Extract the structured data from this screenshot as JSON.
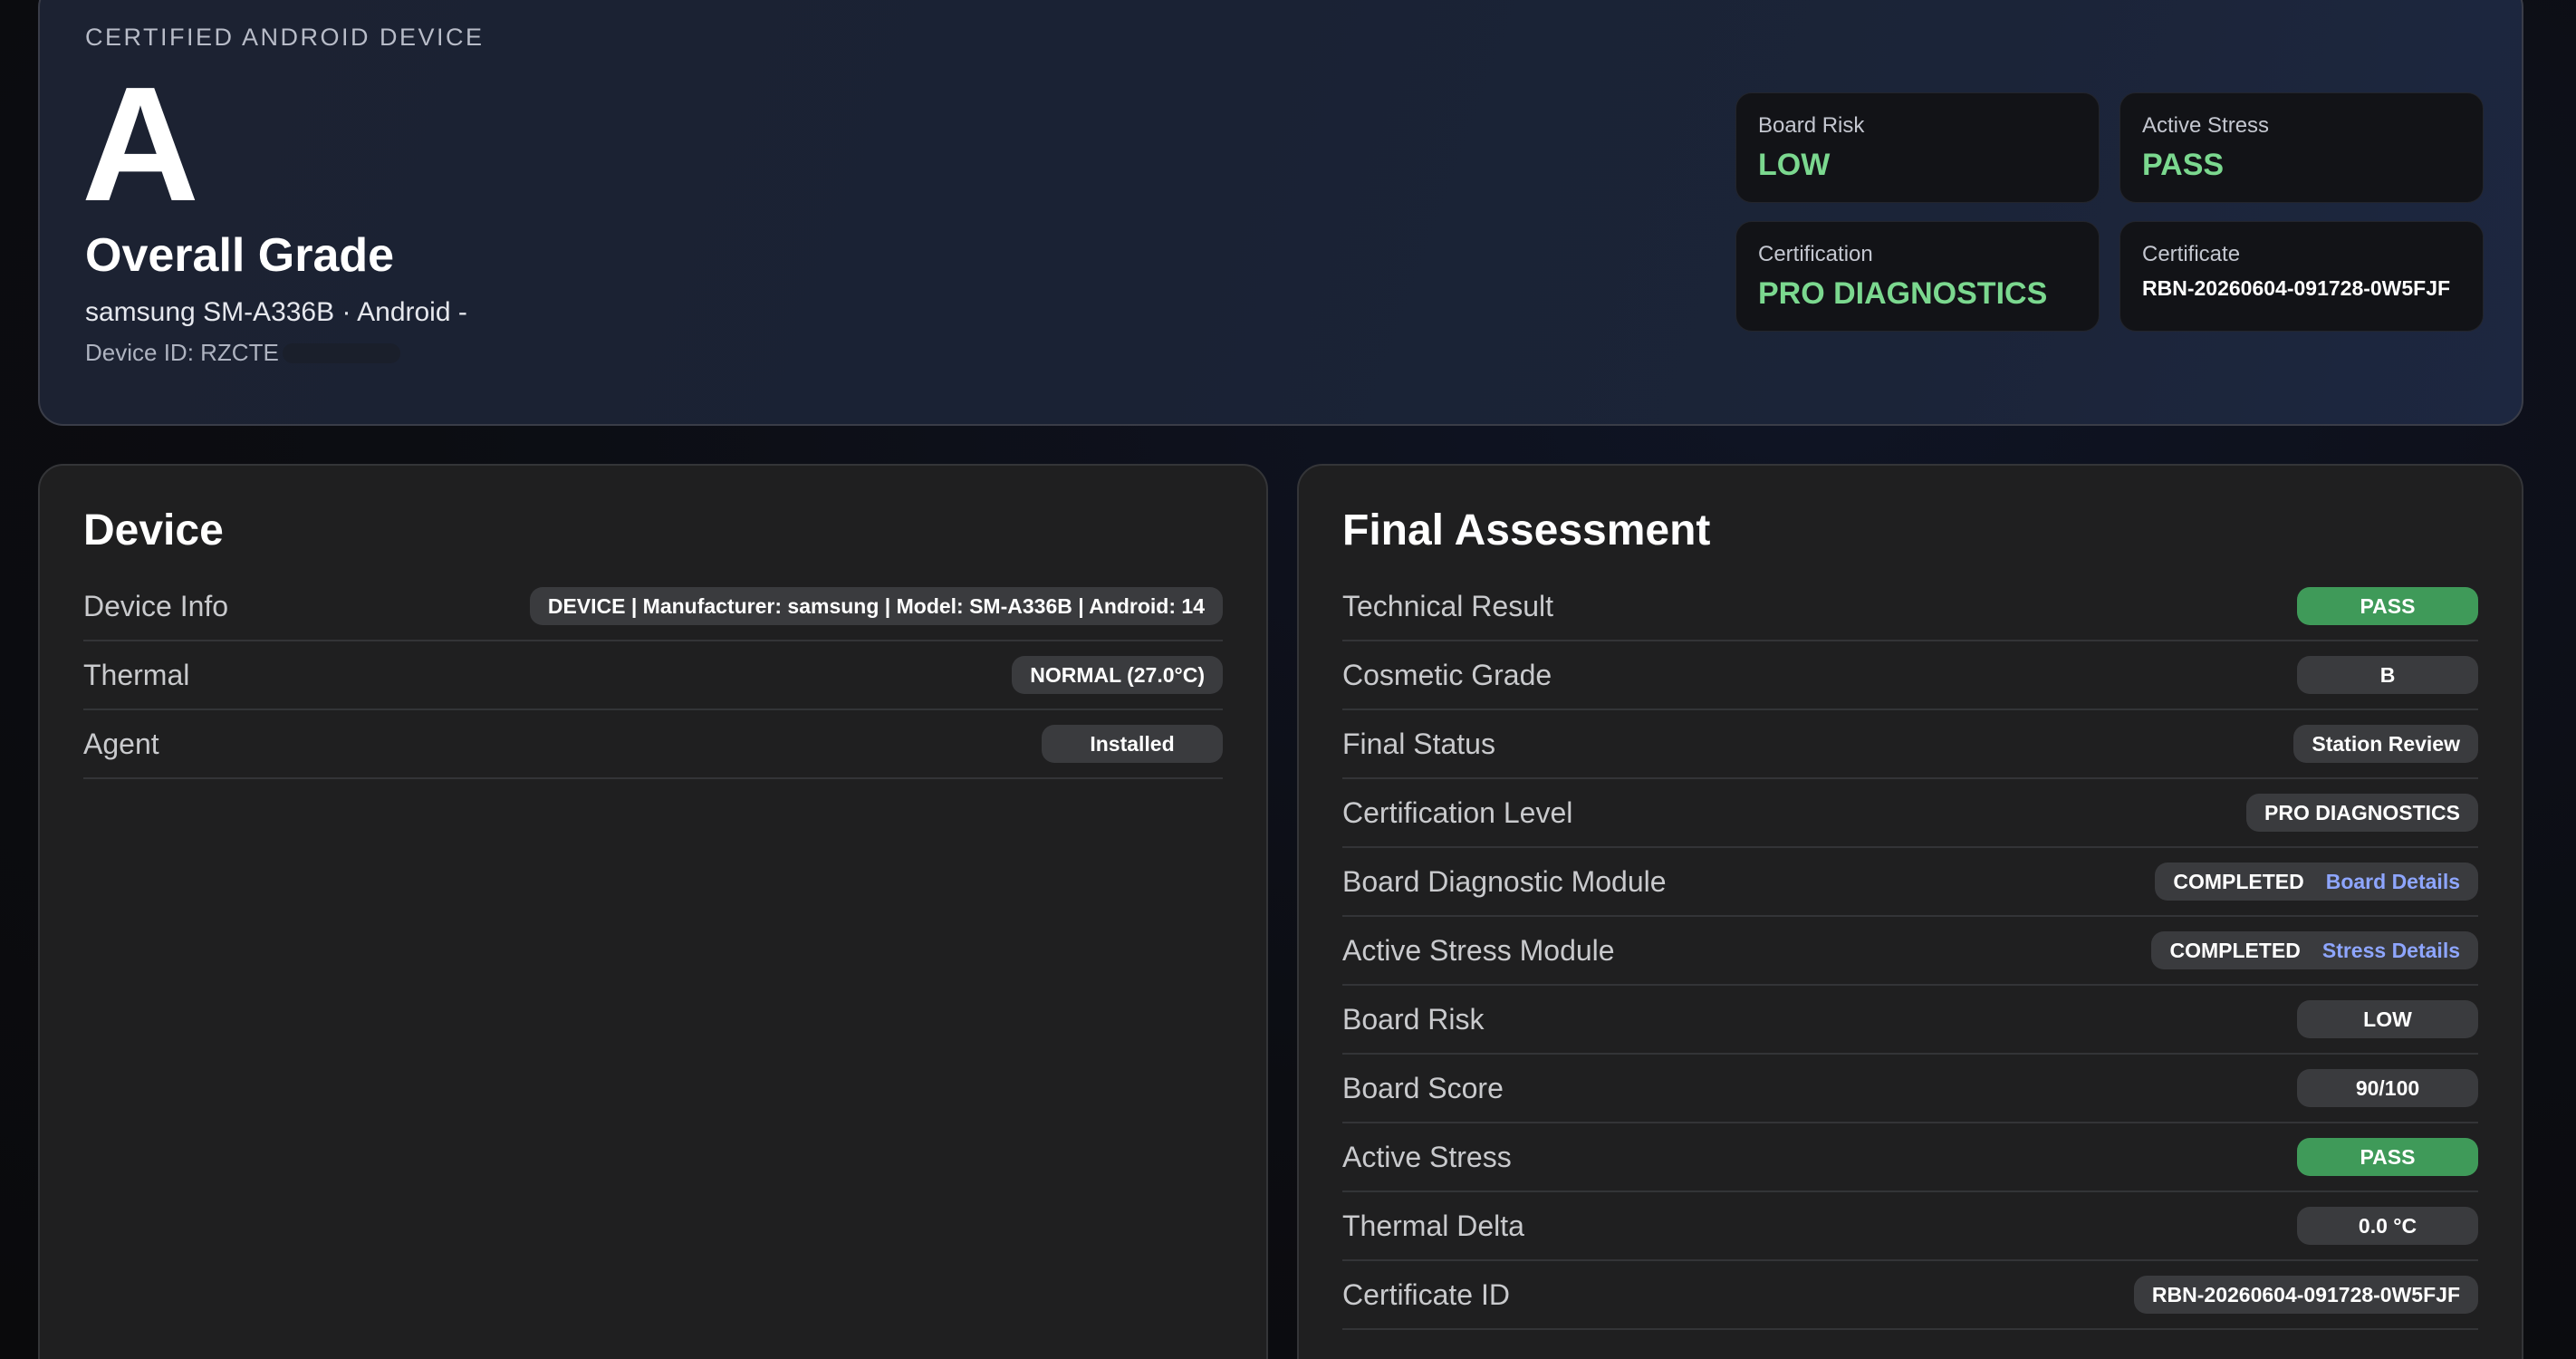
{
  "hero": {
    "eyebrow": "CERTIFIED ANDROID DEVICE",
    "grade": "A",
    "title": "Overall Grade",
    "subtitle": "samsung SM-A336B · Android -",
    "device_id_prefix": "Device ID: RZCTE"
  },
  "stats": [
    {
      "label": "Board Risk",
      "value": "LOW"
    },
    {
      "label": "Active Stress",
      "value": "PASS"
    },
    {
      "label": "Certification",
      "value": "PRO DIAGNOSTICS"
    },
    {
      "label": "Certificate",
      "value": "RBN-20260604-091728-0W5FJF"
    }
  ],
  "device_panel": {
    "title": "Device",
    "rows": [
      {
        "label": "Device Info",
        "value": "DEVICE | Manufacturer: samsung | Model: SM-A336B | Android: 14"
      },
      {
        "label": "Thermal",
        "value": "NORMAL (27.0°C)"
      },
      {
        "label": "Agent",
        "value": "Installed"
      }
    ]
  },
  "final_panel": {
    "title": "Final Assessment",
    "rows": [
      {
        "label": "Technical Result",
        "value": "PASS"
      },
      {
        "label": "Cosmetic Grade",
        "value": "B"
      },
      {
        "label": "Final Status",
        "value": "Station Review"
      },
      {
        "label": "Certification Level",
        "value": "PRO DIAGNOSTICS"
      },
      {
        "label": "Board Diagnostic Module",
        "value": "COMPLETED",
        "link": "Board Details"
      },
      {
        "label": "Active Stress Module",
        "value": "COMPLETED",
        "link": "Stress Details"
      },
      {
        "label": "Board Risk",
        "value": "LOW"
      },
      {
        "label": "Board Score",
        "value": "90/100"
      },
      {
        "label": "Active Stress",
        "value": "PASS"
      },
      {
        "label": "Thermal Delta",
        "value": "0.0 °C"
      },
      {
        "label": "Certificate ID",
        "value": "RBN-20260604-091728-0W5FJF"
      }
    ]
  },
  "colors": {
    "accent_green": "#7bd88f",
    "pill_green": "#3f9a59",
    "link_blue": "#8ea6ff"
  }
}
